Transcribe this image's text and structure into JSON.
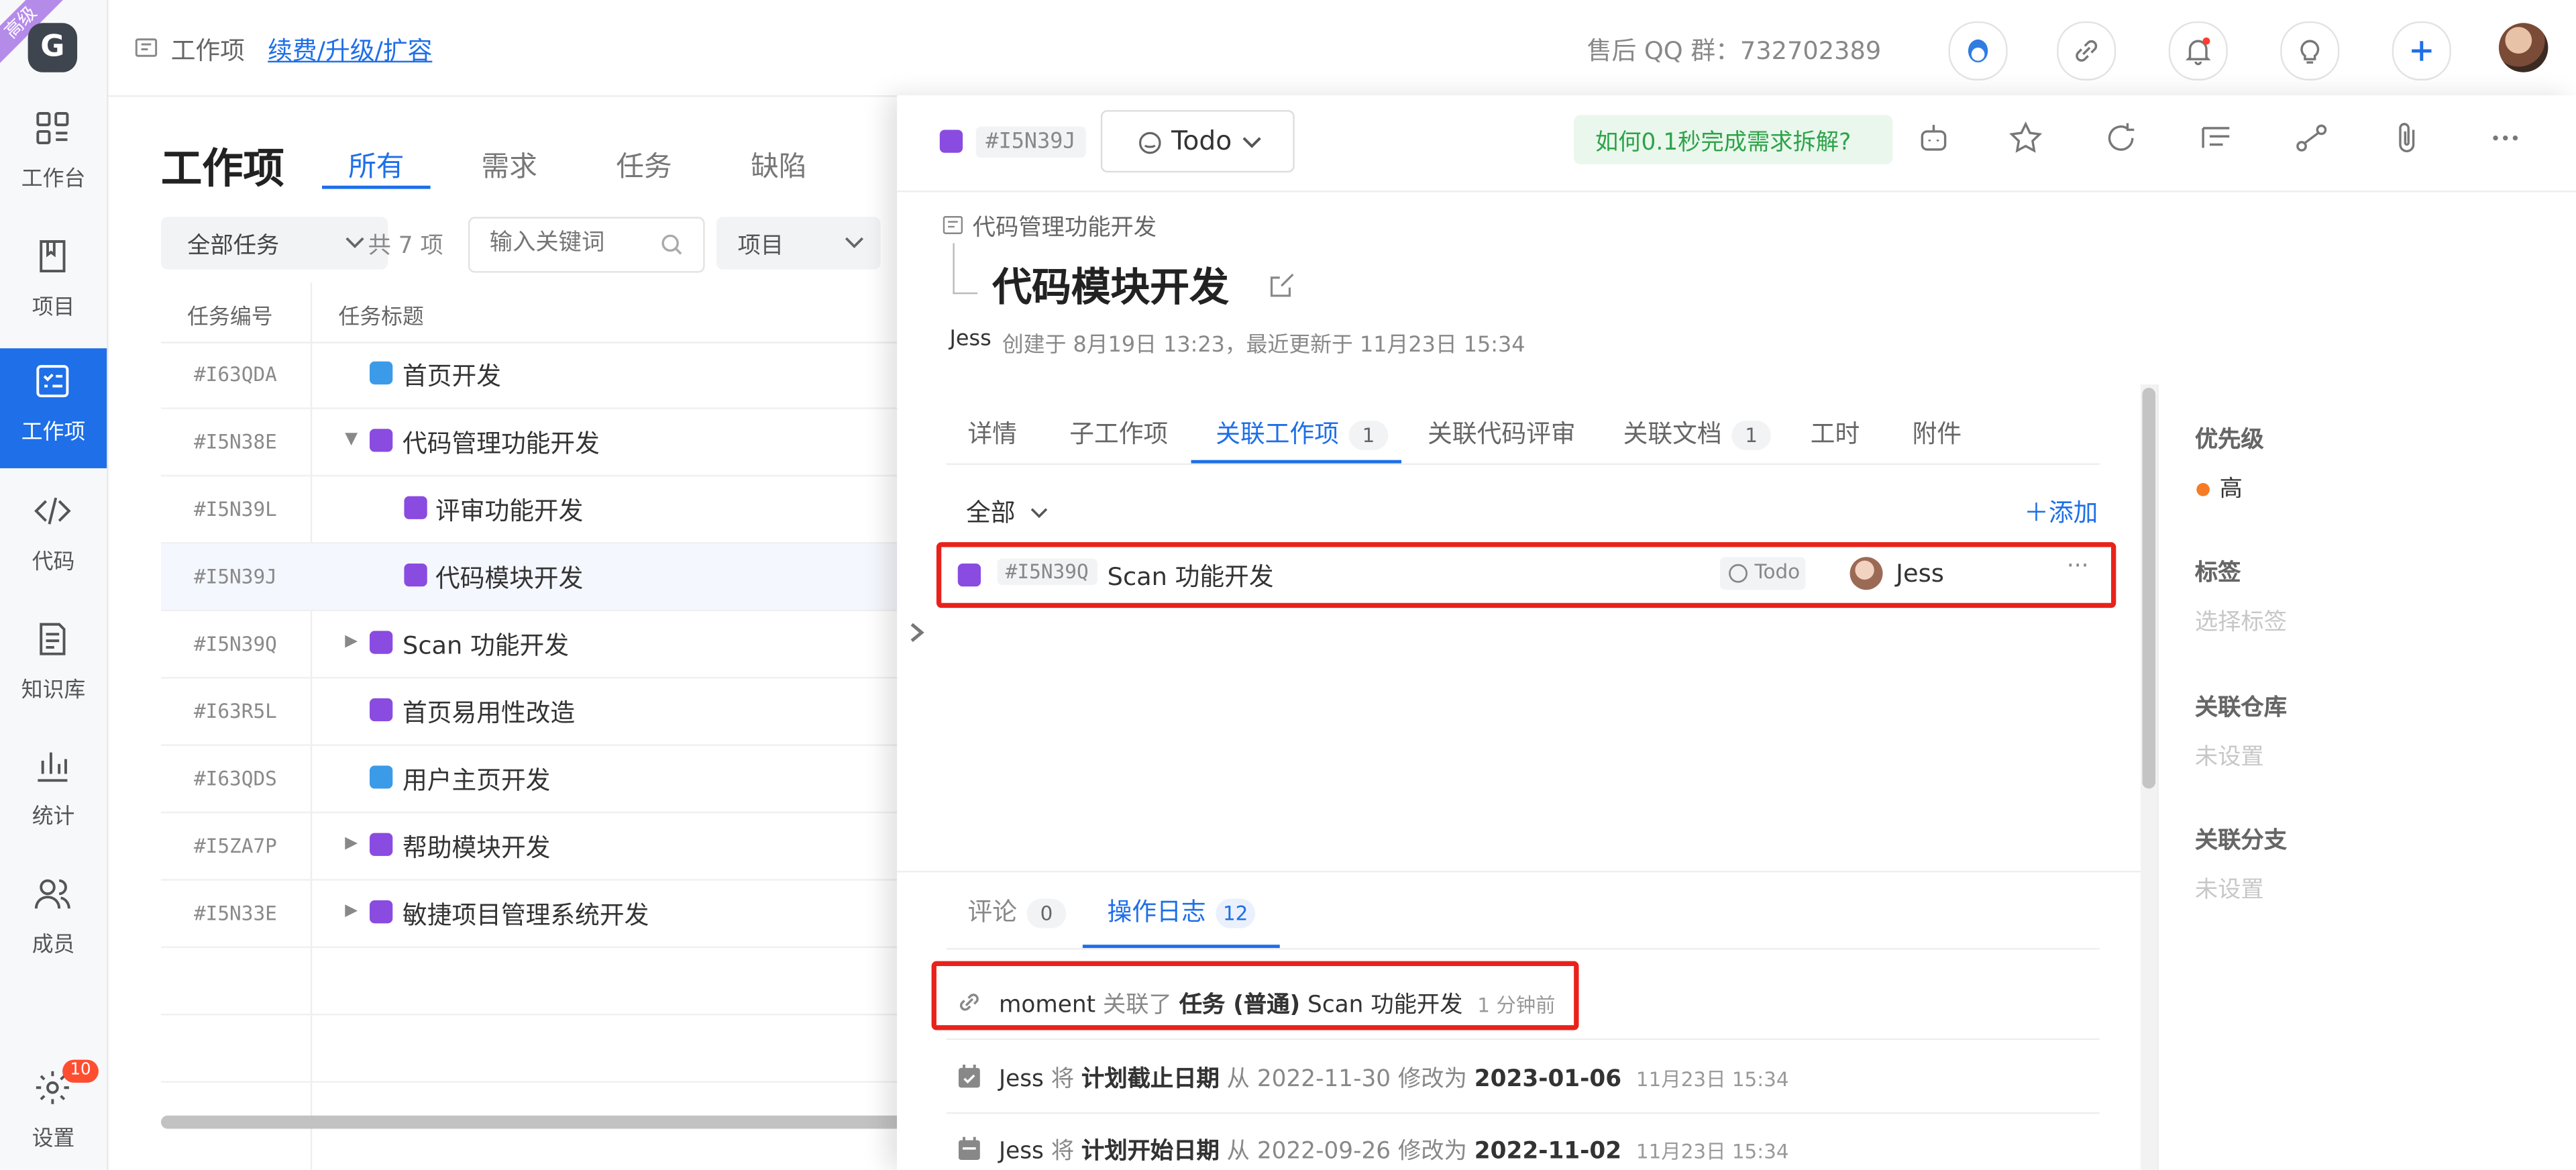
{
  "brand": {
    "ribbon": "高级",
    "logo_letter": "G"
  },
  "rail": {
    "items": [
      {
        "label": "工作台"
      },
      {
        "label": "项目"
      },
      {
        "label": "工作项"
      },
      {
        "label": "代码"
      },
      {
        "label": "知识库"
      },
      {
        "label": "统计"
      },
      {
        "label": "成员"
      },
      {
        "label": "设置"
      }
    ],
    "settings_badge": "10"
  },
  "topbar": {
    "crumb": "工作项",
    "renew_link": "续费/升级/扩容",
    "qq_group": "售后 QQ 群：732702389"
  },
  "list": {
    "title": "工作项",
    "tabs": [
      "所有",
      "需求",
      "任务",
      "缺陷"
    ],
    "filter_all": "全部任务",
    "count": "共 7 项",
    "search_placeholder": "输入关键词",
    "project_select": "项目",
    "columns": [
      "任务编号",
      "任务标题"
    ],
    "rows": [
      {
        "id": "#I63QDA",
        "title": "首页开发"
      },
      {
        "id": "#I5N38E",
        "title": "代码管理功能开发"
      },
      {
        "id": "#I5N39L",
        "title": "评审功能开发"
      },
      {
        "id": "#I5N39J",
        "title": "代码模块开发"
      },
      {
        "id": "#I5N39Q",
        "title": "Scan 功能开发"
      },
      {
        "id": "#I63R5L",
        "title": "首页易用性改造"
      },
      {
        "id": "#I63QDS",
        "title": "用户主页开发"
      },
      {
        "id": "#I5ZA7P",
        "title": "帮助模块开发"
      },
      {
        "id": "#I5N33E",
        "title": "敏捷项目管理系统开发"
      }
    ]
  },
  "detail": {
    "id": "#I5N39J",
    "status": "Todo",
    "promo": "如何0.1秒完成需求拆解?",
    "parent": "代码管理功能开发",
    "title": "代码模块开发",
    "author": "Jess",
    "meta": "创建于 8月19日 13:23，最近更新于 11月23日 15:34",
    "tabs": [
      {
        "label": "详情",
        "count": ""
      },
      {
        "label": "子工作项",
        "count": ""
      },
      {
        "label": "关联工作项",
        "count": "1"
      },
      {
        "label": "关联代码评审",
        "count": ""
      },
      {
        "label": "关联文档",
        "count": "1"
      },
      {
        "label": "工时",
        "count": ""
      },
      {
        "label": "附件",
        "count": ""
      }
    ],
    "filter": "全部",
    "add": "添加",
    "linked": {
      "id": "#I5N39Q",
      "title": "Scan 功能开发",
      "status": "Todo",
      "assignee": "Jess"
    },
    "log_tabs": [
      {
        "label": "评论",
        "count": "0"
      },
      {
        "label": "操作日志",
        "count": "12"
      }
    ],
    "logs": [
      {
        "user": "moment",
        "verb": "关联了",
        "bold": "任务 (普通)",
        "rest": "Scan 功能开发",
        "time": "1 分钟前"
      },
      {
        "user": "Jess",
        "verb": "将",
        "bold": "计划截止日期",
        "rest": "从 2022-11-30 修改为",
        "bold2": "2023-01-06",
        "time": "11月23日 15:34"
      },
      {
        "user": "Jess",
        "verb": "将",
        "bold": "计划开始日期",
        "rest": "从 2022-09-26 修改为",
        "bold2": "2022-11-02",
        "time": "11月23日 15:34"
      }
    ],
    "side": {
      "priority_label": "优先级",
      "priority_value": "高",
      "tag_label": "标签",
      "tag_placeholder": "选择标签",
      "repo_label": "关联仓库",
      "repo_value": "未设置",
      "branch_label": "关联分支",
      "branch_value": "未设置"
    }
  },
  "colors": {
    "accent": "#1e6fe8",
    "highlight_box": "#e8221b",
    "task_purple": "#8a4be0",
    "priority_orange": "#f57c25"
  }
}
